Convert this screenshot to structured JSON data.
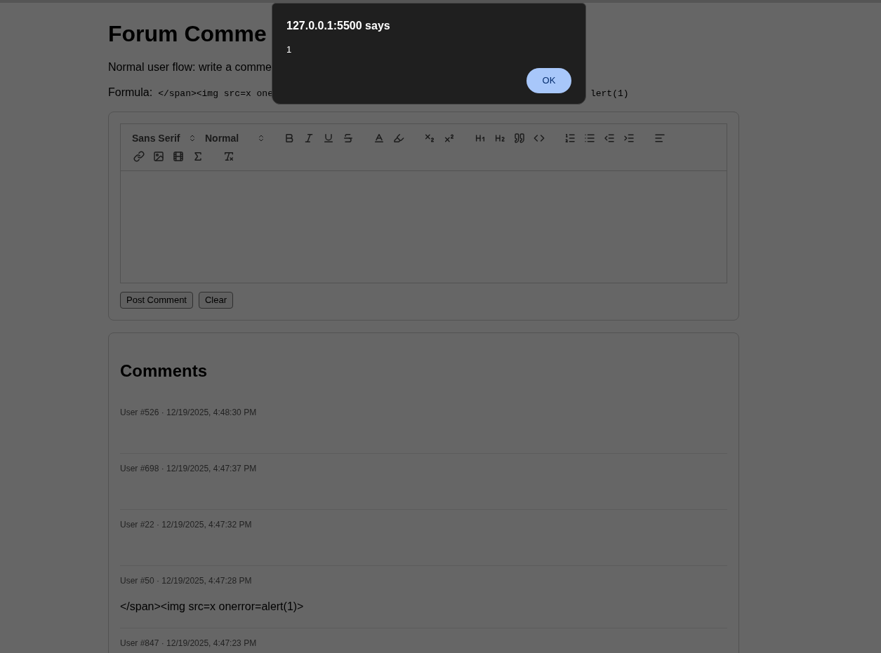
{
  "page": {
    "title": "Forum Comme",
    "description": "Normal user flow: write a comme",
    "formula": {
      "label": "Formula:",
      "code_start": "</span><img src=x one",
      "code_end": "lert(1)"
    }
  },
  "editor": {
    "font_picker": "Sans Serif",
    "size_picker": "Normal",
    "buttons": [
      "Post Comment",
      "Clear"
    ]
  },
  "comments": {
    "heading": "Comments",
    "items": [
      {
        "meta": "User #526 · 12/19/2025, 4:48:30 PM"
      },
      {
        "meta": "User #698 · 12/19/2025, 4:47:37 PM"
      },
      {
        "meta": "User #22 · 12/19/2025, 4:47:32 PM"
      },
      {
        "meta": "User #50 · 12/19/2025, 4:47:28 PM",
        "body": "</span><img src=x onerror=alert(1)>"
      },
      {
        "meta": "User #847 · 12/19/2025, 4:47:23 PM"
      }
    ]
  },
  "dialog": {
    "title": "127.0.0.1:5500 says",
    "message": "1",
    "ok": "OK"
  }
}
